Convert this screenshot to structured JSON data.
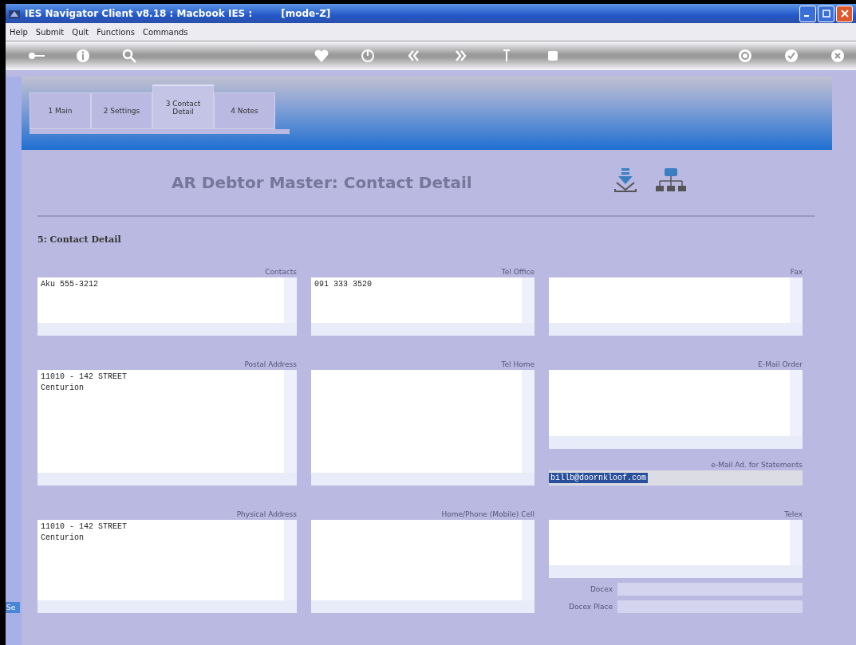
{
  "window": {
    "title": "IES Navigator Client v8.18 : Macbook IES :",
    "mode": "[mode-Z]"
  },
  "menu": [
    "Help",
    "Submit",
    "Quit",
    "Functions",
    "Commands"
  ],
  "tabs": [
    {
      "label": "1 Main",
      "selected": false
    },
    {
      "label": "2 Settings",
      "selected": false
    },
    {
      "label": "3 Contact Detail",
      "selected": true
    },
    {
      "label": "4 Notes",
      "selected": false
    }
  ],
  "heading": "AR Debtor Master: Contact Detail",
  "section": "5: Contact Detail",
  "rows": [
    [
      [
        {
          "kind": "text_area",
          "label": "Contacts",
          "lines": [
            "Aku 555-3212"
          ]
        }
      ],
      [
        {
          "kind": "text_area",
          "label": "Tel Office",
          "lines": [
            "091 333 3520"
          ]
        }
      ],
      [
        {
          "kind": "text_area",
          "label": "Fax"
        }
      ]
    ],
    [
      [
        {
          "kind": "text_area",
          "label": "Postal Address",
          "lines": [
            "11010 - 142 STREET",
            "Centurion"
          ]
        }
      ],
      [
        {
          "kind": "text_area",
          "label": "Tel Home"
        }
      ],
      [
        {
          "kind": "text_area",
          "label": "E-Mail Order"
        },
        {
          "kind": "line",
          "label": "e-Mail Ad. for Statements",
          "value": "billb@doornkloof.com",
          "selected": true
        }
      ]
    ],
    [
      [
        {
          "kind": "text_area",
          "label": "Physical Address",
          "lines": [
            "11010 - 142 STREET",
            "Centurion"
          ]
        }
      ],
      [
        {
          "kind": "text_area",
          "label": "Home/Phone (Mobile) Cell"
        }
      ],
      [
        {
          "kind": "text_area",
          "label": "Telex"
        },
        {
          "kind": "inline_line",
          "label": "Docex"
        },
        {
          "kind": "inline_line",
          "label": "Docex Place"
        }
      ]
    ]
  ],
  "side_tab": "Se"
}
